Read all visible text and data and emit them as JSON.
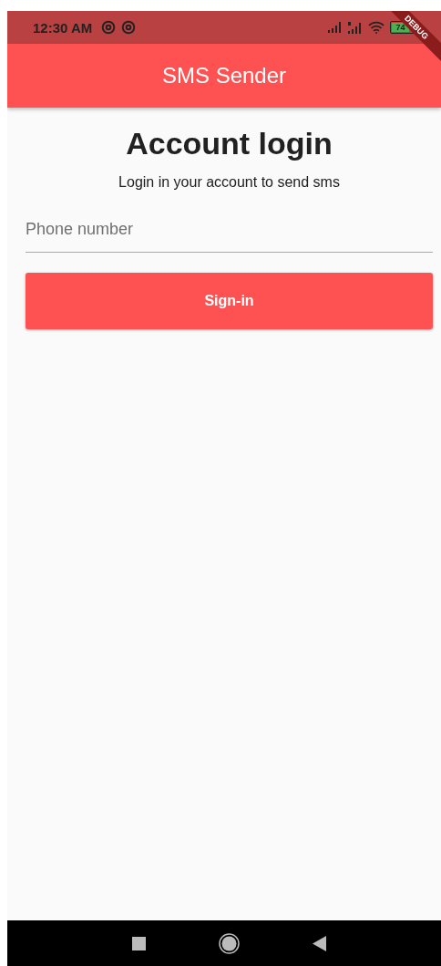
{
  "status_bar": {
    "time": "12:30 AM",
    "battery": "74"
  },
  "debug_banner": "DEBUG",
  "app_bar": {
    "title": "SMS Sender"
  },
  "login": {
    "heading": "Account login",
    "subtitle": "Login in your account to send sms",
    "phone_field": {
      "placeholder": "Phone number"
    },
    "button": "Sign-in"
  }
}
